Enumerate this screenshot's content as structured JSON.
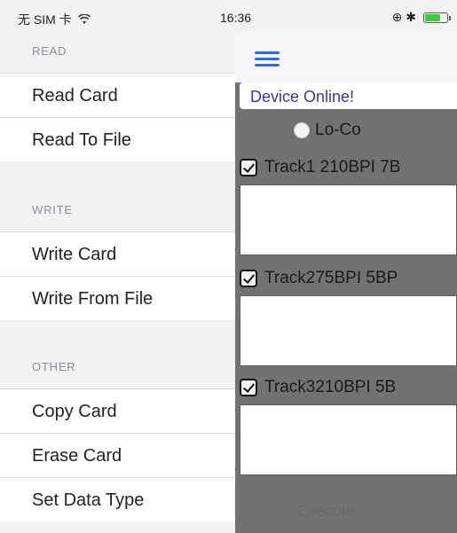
{
  "status_bar": {
    "carrier": "无 SIM 卡",
    "wifi_icon": "wifi-icon",
    "time": "16:36",
    "right_indicators": "⊕ ✱",
    "battery_color": "#3ccb3c",
    "battery_level": 0.7
  },
  "menu": {
    "sections": [
      {
        "header": "READ",
        "items": [
          "Read Card",
          "Read To File"
        ]
      },
      {
        "header": "WRITE",
        "items": [
          "Write Card",
          "Write From File"
        ]
      },
      {
        "header": "OTHER",
        "items": [
          "Copy Card",
          "Erase Card",
          "Set Data Type"
        ]
      }
    ]
  },
  "main": {
    "menu_icon": "hamburger-menu-icon",
    "accent_color": "#2a6fdb",
    "status_text": "Device Online!",
    "coercivity_option": "Lo-Co",
    "tracks": [
      {
        "label": "Track1 210BPI 7B",
        "checked": true,
        "value": ""
      },
      {
        "label": "Track275BPI 5BP",
        "checked": true,
        "value": ""
      },
      {
        "label": "Track3210BPI 5B",
        "checked": true,
        "value": ""
      }
    ],
    "bottom_button": "Execute"
  }
}
